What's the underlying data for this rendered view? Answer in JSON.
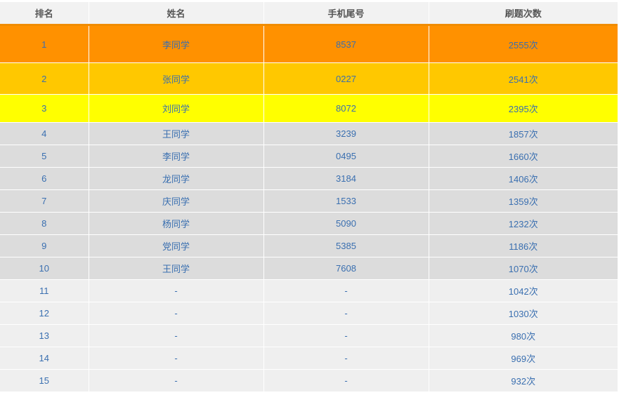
{
  "header": {
    "rank": "排名",
    "name": "姓名",
    "phone": "手机尾号",
    "count": "刷题次数"
  },
  "rows": [
    {
      "rank": "1",
      "name": "李同学",
      "phone": "8537",
      "count": "2555次"
    },
    {
      "rank": "2",
      "name": "张同学",
      "phone": "0227",
      "count": "2541次"
    },
    {
      "rank": "3",
      "name": "刘同学",
      "phone": "8072",
      "count": "2395次"
    },
    {
      "rank": "4",
      "name": "王同学",
      "phone": "3239",
      "count": "1857次"
    },
    {
      "rank": "5",
      "name": "李同学",
      "phone": "0495",
      "count": "1660次"
    },
    {
      "rank": "6",
      "name": "龙同学",
      "phone": "3184",
      "count": "1406次"
    },
    {
      "rank": "7",
      "name": "庆同学",
      "phone": "1533",
      "count": "1359次"
    },
    {
      "rank": "8",
      "name": "杨同学",
      "phone": "5090",
      "count": "1232次"
    },
    {
      "rank": "9",
      "name": "党同学",
      "phone": "5385",
      "count": "1186次"
    },
    {
      "rank": "10",
      "name": "王同学",
      "phone": "7608",
      "count": "1070次"
    },
    {
      "rank": "11",
      "name": "-",
      "phone": "-",
      "count": "1042次"
    },
    {
      "rank": "12",
      "name": "-",
      "phone": "-",
      "count": "1030次"
    },
    {
      "rank": "13",
      "name": "-",
      "phone": "-",
      "count": "980次"
    },
    {
      "rank": "14",
      "name": "-",
      "phone": "-",
      "count": "969次"
    },
    {
      "rank": "15",
      "name": "-",
      "phone": "-",
      "count": "932次"
    }
  ],
  "colors": {
    "first_place": "#ff9100",
    "second_place": "#ffc800",
    "third_place": "#ffff00",
    "top_ten": "#dcdcdc",
    "others": "#efefef",
    "header_accent": "#f08c00",
    "text": "#3a6fb0"
  }
}
